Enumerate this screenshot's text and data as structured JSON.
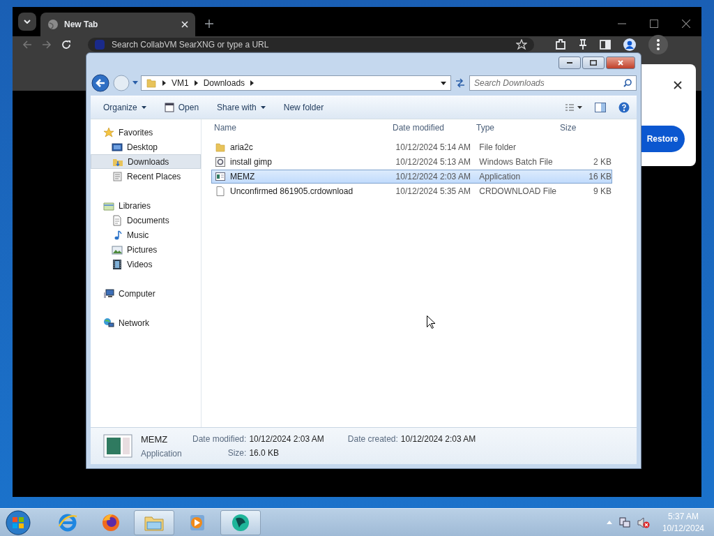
{
  "browser": {
    "tab_title": "New Tab",
    "address_placeholder": "Search CollabVM SearXNG or type a URL",
    "popup_button": "Restore"
  },
  "explorer": {
    "breadcrumb": [
      "VM1",
      "Downloads"
    ],
    "search_placeholder": "Search Downloads",
    "toolbar": [
      {
        "label": "Organize",
        "kind": "menu"
      },
      {
        "label": "Open",
        "kind": "icon"
      },
      {
        "label": "Share with",
        "kind": "menu"
      },
      {
        "label": "New folder",
        "kind": "plain"
      }
    ],
    "nav": [
      {
        "label": "Favorites",
        "kind": "star",
        "selected": false,
        "children": [
          {
            "label": "Desktop",
            "kind": "desktop",
            "selected": false
          },
          {
            "label": "Downloads",
            "kind": "downloads",
            "selected": true
          },
          {
            "label": "Recent Places",
            "kind": "recent",
            "selected": false
          }
        ]
      },
      {
        "label": "Libraries",
        "kind": "library",
        "selected": false,
        "children": [
          {
            "label": "Documents",
            "kind": "document",
            "selected": false
          },
          {
            "label": "Music",
            "kind": "music",
            "selected": false
          },
          {
            "label": "Pictures",
            "kind": "pictures",
            "selected": false
          },
          {
            "label": "Videos",
            "kind": "videos",
            "selected": false
          }
        ]
      },
      {
        "label": "Computer",
        "kind": "computer",
        "selected": false
      },
      {
        "label": "Network",
        "kind": "network",
        "selected": false
      }
    ],
    "columns": [
      "Name",
      "Date modified",
      "Type",
      "Size"
    ],
    "files": [
      {
        "name": "aria2c",
        "date": "10/12/2024 5:14 AM",
        "type": "File folder",
        "kind": "folder",
        "selected": false
      },
      {
        "name": "install gimp",
        "date": "10/12/2024 5:13 AM",
        "type": "Windows Batch File",
        "size": "2 KB",
        "kind": "batch",
        "selected": false
      },
      {
        "name": "MEMZ",
        "date": "10/12/2024 2:03 AM",
        "type": "Application",
        "size": "16 KB",
        "kind": "app",
        "selected": true
      },
      {
        "name": "Unconfirmed 861905.crdownload",
        "date": "10/12/2024 5:35 AM",
        "type": "CRDOWNLOAD File",
        "size": "9 KB",
        "kind": "file",
        "selected": false
      }
    ],
    "details": {
      "name": "MEMZ",
      "type": "Application",
      "fields": [
        {
          "label": "Date modified:",
          "value": "10/12/2024 2:03 AM"
        },
        {
          "label": "Date created:",
          "value": "10/12/2024 2:03 AM"
        },
        {
          "label": "Size:",
          "value": "16.0 KB"
        }
      ]
    }
  },
  "taskbar": {
    "apps": [
      {
        "kind": "browser-e",
        "active": false
      },
      {
        "kind": "fox",
        "active": false
      },
      {
        "kind": "folders",
        "active": true
      },
      {
        "kind": "player",
        "active": false
      },
      {
        "kind": "disc",
        "active": true
      }
    ],
    "clock": {
      "time": "5:37 AM",
      "date": "10/12/2024"
    }
  }
}
